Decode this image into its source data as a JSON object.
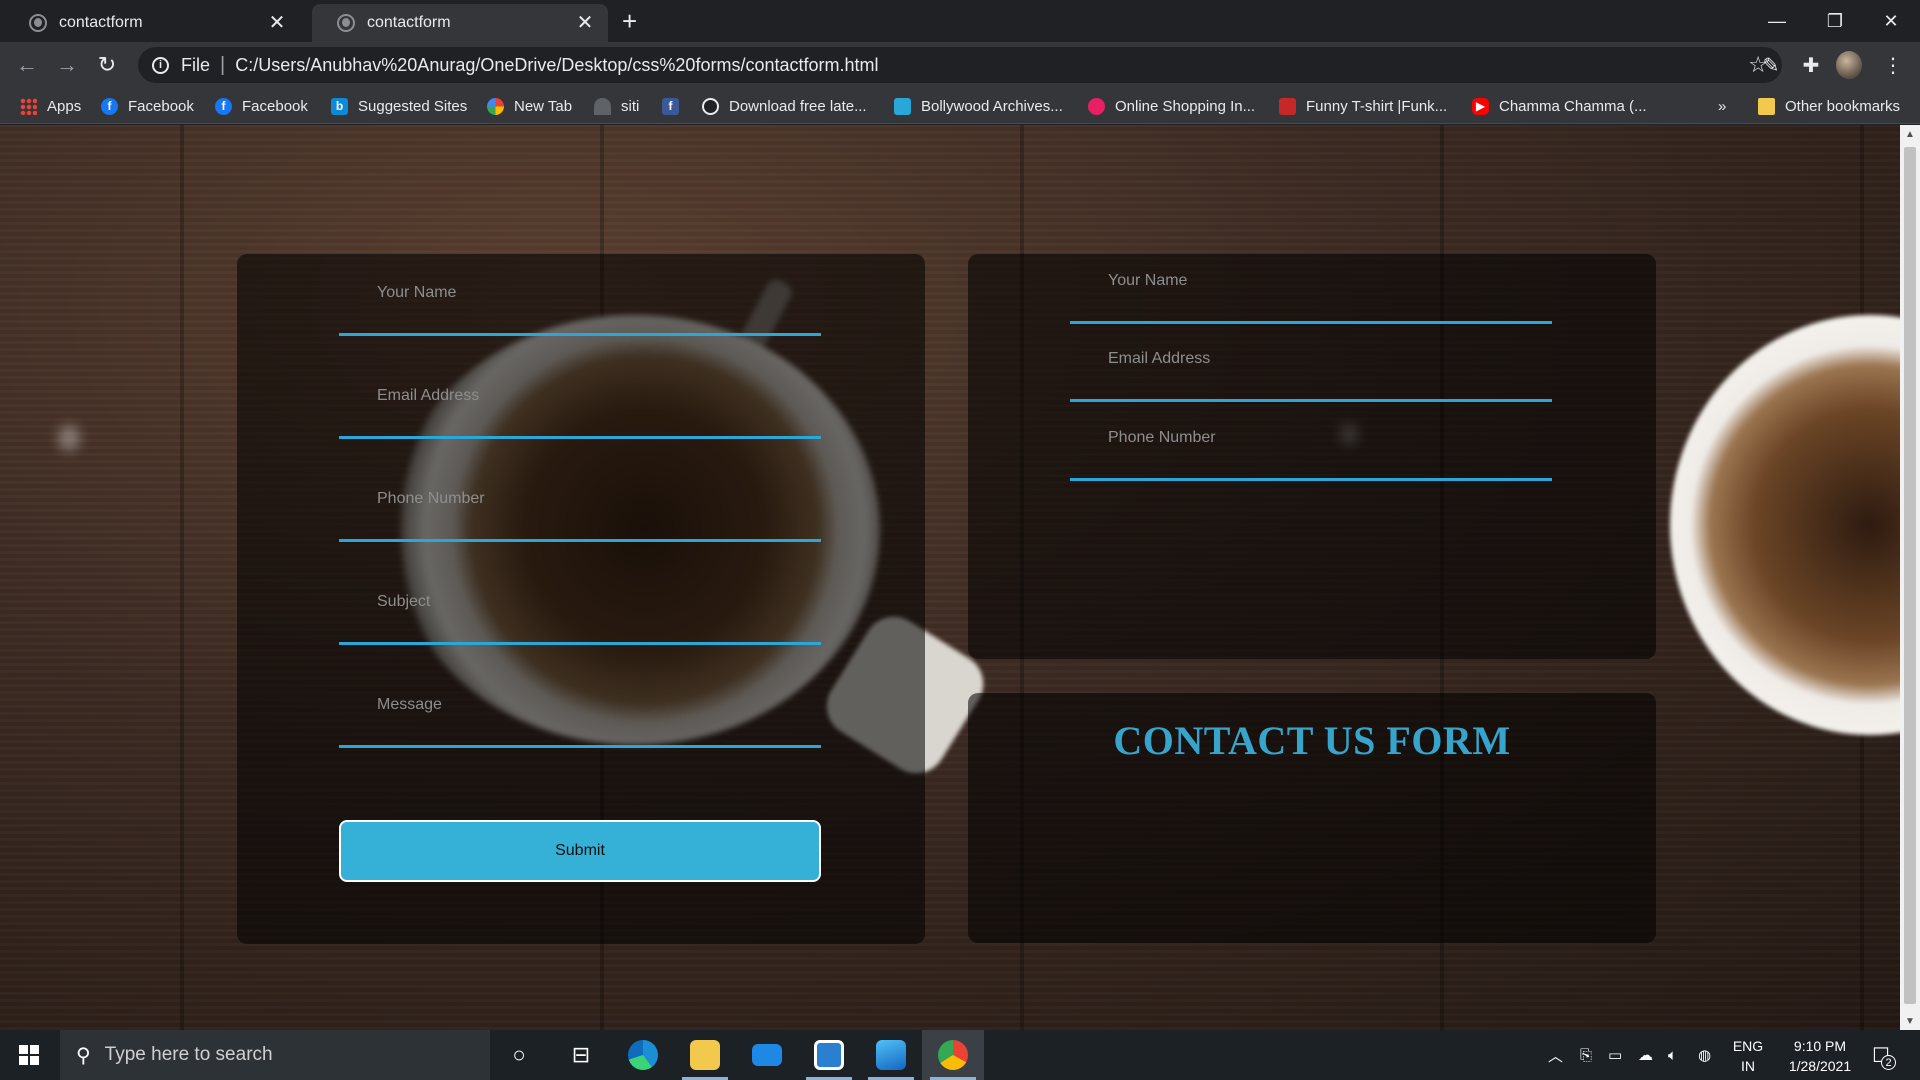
{
  "browser": {
    "tabs": [
      {
        "title": "contactform",
        "active": false
      },
      {
        "title": "contactform",
        "active": true
      }
    ],
    "new_tab_symbol": "+",
    "window_controls": {
      "minimize": "—",
      "restore": "❐",
      "close": "✕"
    },
    "address": {
      "scheme": "File",
      "separator": "|",
      "url": "C:/Users/Anubhav%20Anurag/OneDrive/Desktop/css%20forms/contactform.html"
    },
    "bookmarks": [
      {
        "label": "Apps",
        "icon": "apps-grid-icon"
      },
      {
        "label": "Facebook",
        "icon": "facebook-icon"
      },
      {
        "label": "Facebook",
        "icon": "facebook-icon"
      },
      {
        "label": "Suggested Sites",
        "icon": "bing-icon"
      },
      {
        "label": "New Tab",
        "icon": "google-icon"
      },
      {
        "label": "siti",
        "icon": "siti-icon"
      },
      {
        "label": "",
        "icon": "facebook-square-icon"
      },
      {
        "label": "Download free late...",
        "icon": "globe-icon"
      },
      {
        "label": "Bollywood Archives...",
        "icon": "bollywood-icon"
      },
      {
        "label": "Online Shopping In...",
        "icon": "shopping-icon"
      },
      {
        "label": "Funny T-shirt |Funk...",
        "icon": "funk-icon"
      },
      {
        "label": "Chamma Chamma (...",
        "icon": "youtube-icon"
      }
    ],
    "bookmarks_overflow": "»",
    "other_bookmarks": "Other bookmarks"
  },
  "page": {
    "left_form": {
      "fields": [
        {
          "placeholder": "Your Name"
        },
        {
          "placeholder": "Email Address"
        },
        {
          "placeholder": "Phone Number"
        },
        {
          "placeholder": "Subject"
        },
        {
          "placeholder": "Message"
        }
      ],
      "submit_label": "Submit"
    },
    "right_form": {
      "fields": [
        {
          "placeholder": "Your Name"
        },
        {
          "placeholder": "Email Address"
        },
        {
          "placeholder": "Phone Number"
        }
      ]
    },
    "heading": "CONTACT US FORM",
    "colors": {
      "accent": "#2aa6d9",
      "button": "#35b0d6",
      "heading": "#37a4cc"
    }
  },
  "taskbar": {
    "search_placeholder": "Type here to search",
    "apps": [
      "cortana-icon",
      "task-view-icon",
      "edge-icon",
      "file-explorer-icon",
      "mail-icon",
      "app-icon",
      "photos-icon",
      "chrome-icon"
    ],
    "language": {
      "line1": "ENG",
      "line2": "IN"
    },
    "clock": {
      "time": "9:10 PM",
      "date": "1/28/2021"
    },
    "notifications_count": "2"
  }
}
